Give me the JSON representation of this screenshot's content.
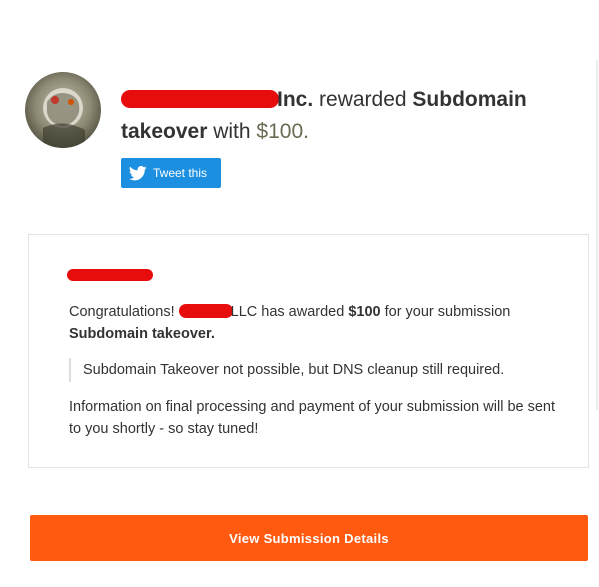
{
  "header": {
    "company_suffix": "Inc.",
    "rewarded_text": " rewarded ",
    "report_title_line1": "Subdomain",
    "report_title_line2": "takeover",
    "with_text": " with ",
    "amount": "$100",
    "period": ".",
    "tweet_label": "Tweet this"
  },
  "message": {
    "congrats": "Congratulations! ",
    "company_suffix": "LLC has awarded ",
    "amount": "$100",
    "for_text": " for your submission",
    "submission_title": "Subdomain takeover.",
    "quote": "Subdomain Takeover not possible, but DNS cleanup still required.",
    "info": "Information on final processing and payment of your submission will be sent to you shortly - so stay tuned!"
  },
  "actions": {
    "view_label": "View Submission Details"
  },
  "colors": {
    "accent": "#ff5a10",
    "twitter": "#1d8fe0",
    "redaction": "#e80d0d"
  }
}
